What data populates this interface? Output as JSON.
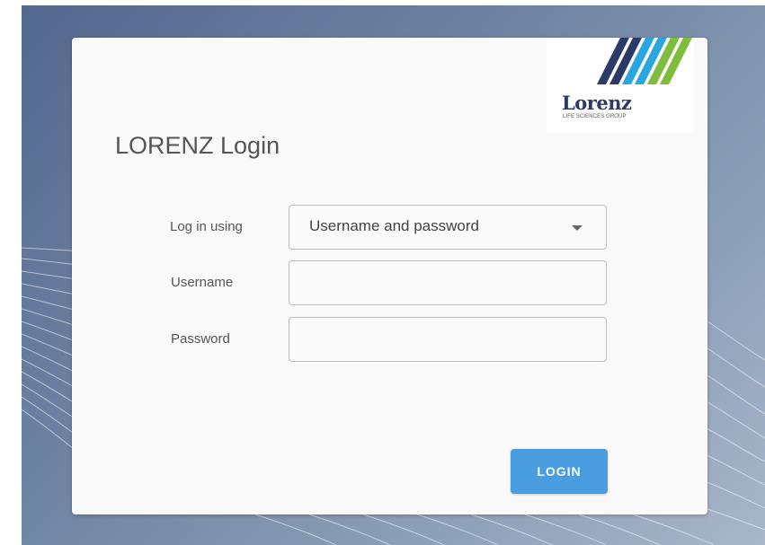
{
  "brand": {
    "logo_text": "Lorenz",
    "logo_subtitle": "LIFE SCIENCES GROUP",
    "stripe_colors": [
      "#2b3a67",
      "#2aa6de",
      "#7dbd3b"
    ]
  },
  "form": {
    "title": "LORENZ Login",
    "login_method": {
      "label": "Log in using",
      "selected": "Username and password",
      "icon": "chevron-down-icon"
    },
    "username": {
      "label": "Username",
      "value": ""
    },
    "password": {
      "label": "Password",
      "value": ""
    },
    "submit_label": "LOGIN",
    "accent_color": "#4a9ee0"
  }
}
